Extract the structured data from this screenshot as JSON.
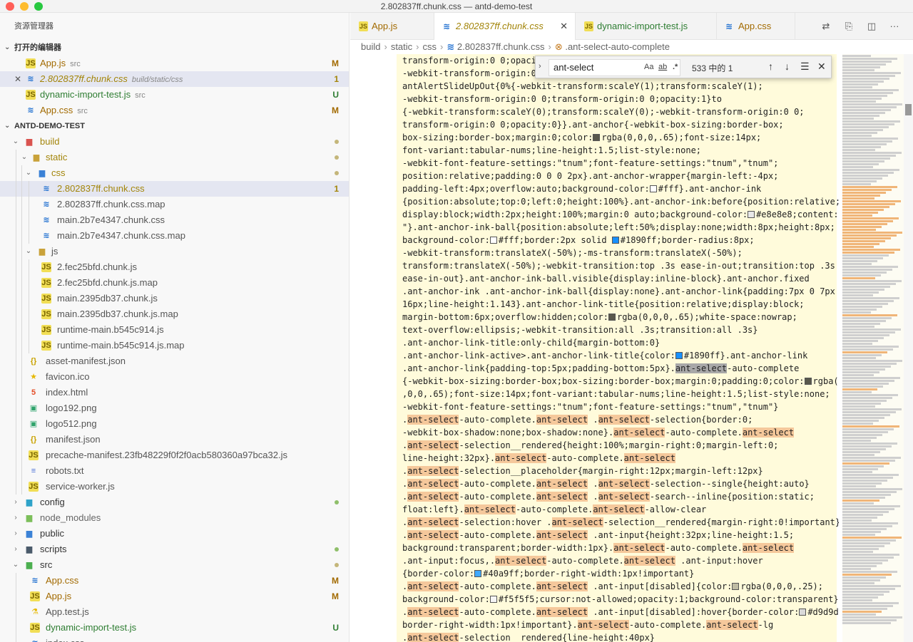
{
  "window": {
    "title": "2.802837ff.chunk.css — antd-demo-test"
  },
  "sidebar": {
    "title": "资源管理器",
    "open_editors_header": "打开的编辑器",
    "open_editors": [
      {
        "name": "App.js",
        "hint": "src",
        "badge": "M"
      },
      {
        "name": "2.802837ff.chunk.css",
        "hint": "build/static/css",
        "badge": "1"
      },
      {
        "name": "dynamic-import-test.js",
        "hint": "src",
        "badge": "U"
      },
      {
        "name": "App.css",
        "hint": "src",
        "badge": "M"
      }
    ],
    "project_header": "ANTD-DEMO-TEST",
    "tree": [
      {
        "name": "build"
      },
      {
        "name": "static"
      },
      {
        "name": "css"
      },
      {
        "name": "2.802837ff.chunk.css",
        "badge": "1"
      },
      {
        "name": "2.802837ff.chunk.css.map"
      },
      {
        "name": "main.2b7e4347.chunk.css"
      },
      {
        "name": "main.2b7e4347.chunk.css.map"
      },
      {
        "name": "js"
      },
      {
        "name": "2.fec25bfd.chunk.js"
      },
      {
        "name": "2.fec25bfd.chunk.js.map"
      },
      {
        "name": "main.2395db37.chunk.js"
      },
      {
        "name": "main.2395db37.chunk.js.map"
      },
      {
        "name": "runtime-main.b545c914.js"
      },
      {
        "name": "runtime-main.b545c914.js.map"
      },
      {
        "name": "asset-manifest.json"
      },
      {
        "name": "favicon.ico"
      },
      {
        "name": "index.html"
      },
      {
        "name": "logo192.png"
      },
      {
        "name": "logo512.png"
      },
      {
        "name": "manifest.json"
      },
      {
        "name": "precache-manifest.23fb48229f0f2f0acb580360a97bca32.js"
      },
      {
        "name": "robots.txt"
      },
      {
        "name": "service-worker.js"
      },
      {
        "name": "config"
      },
      {
        "name": "node_modules"
      },
      {
        "name": "public"
      },
      {
        "name": "scripts"
      },
      {
        "name": "src"
      },
      {
        "name": "App.css",
        "badge": "M"
      },
      {
        "name": "App.js",
        "badge": "M"
      },
      {
        "name": "App.test.js"
      },
      {
        "name": "dynamic-import-test.js",
        "badge": "U"
      },
      {
        "name": "index.css"
      }
    ]
  },
  "tabs": [
    {
      "label": "App.js"
    },
    {
      "label": "2.802837ff.chunk.css",
      "close": "✕"
    },
    {
      "label": "dynamic-import-test.js"
    },
    {
      "label": "App.css"
    }
  ],
  "breadcrumb": [
    "build",
    "static",
    "css",
    "2.802837ff.chunk.css",
    ".ant-select-auto-complete"
  ],
  "find": {
    "query": "ant-select",
    "match_case": "Aa",
    "whole_word": "ab",
    "regex": ".*",
    "count": "533 中的 1"
  },
  "colors": {
    "accent_find": "#f5c89b",
    "editor_bg": "#fffbdb",
    "modified": "#a26a00",
    "untracked": "#2e7d32"
  }
}
